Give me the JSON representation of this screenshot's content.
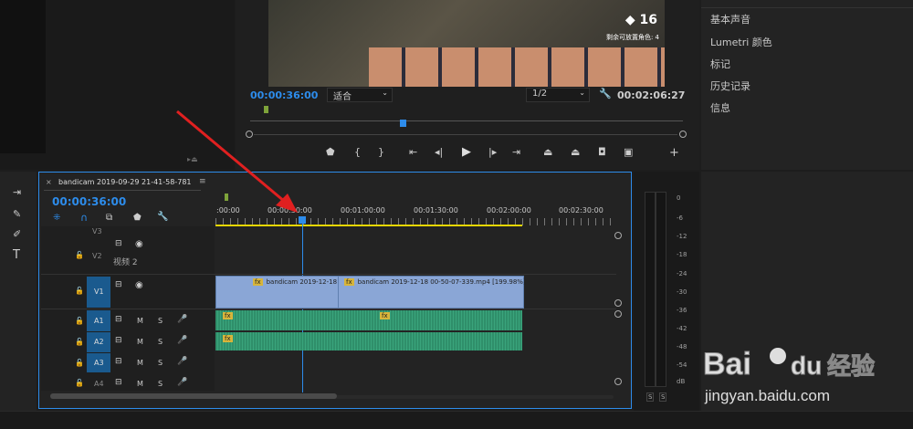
{
  "program": {
    "timecode": "00:00:36:00",
    "fit_label": "适合",
    "resolution": "1/2",
    "duration": "00:02:06:27",
    "game_counter": "16",
    "game_text": "剩余可放置角色: 4"
  },
  "right_panel": {
    "items": [
      "基本声音",
      "Lumetri 颜色",
      "标记",
      "历史记录",
      "信息"
    ]
  },
  "timeline": {
    "sequence_name": "bandicam 2019-09-29 21-41-58-781",
    "timecode": "00:00:36:00",
    "ruler_labels": [
      ":00:00",
      "00:00:30:00",
      "00:01:00:00",
      "00:01:30:00",
      "00:02:00:00",
      "00:02:30:00"
    ],
    "tracks": {
      "v3": "V3",
      "v2": "V2",
      "v1": "V1",
      "a1": "A1",
      "a2": "A2",
      "a3": "A3",
      "a4": "A4",
      "v2_name": "视频 2"
    },
    "clips": {
      "clip1": "bandicam 2019-12-18",
      "clip2": "bandicam 2019-12-18 00-50-07-339.mp4 [199.98%]"
    },
    "mute": "M",
    "solo": "S"
  },
  "meter": {
    "labels": [
      "0",
      "-6",
      "-12",
      "-18",
      "-24",
      "-30",
      "-36",
      "-42",
      "-48",
      "-54",
      "dB"
    ],
    "solo_buttons": [
      "S",
      "S"
    ]
  },
  "watermark": {
    "text": "jingyan.baidu.com"
  },
  "colors": {
    "accent": "#2d8ceb",
    "clip_video": "#8aa6d6",
    "clip_audio": "#2f8f6a",
    "annotation": "#e02020"
  }
}
